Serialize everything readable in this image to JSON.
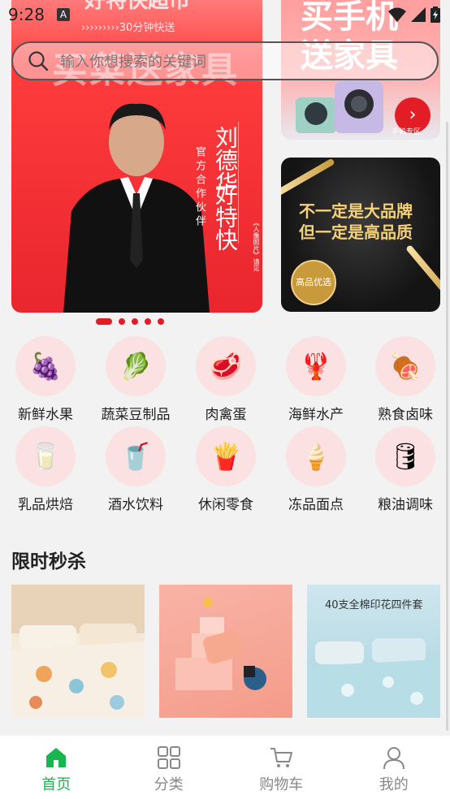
{
  "status": {
    "time": "9:28",
    "notif_icon": "A"
  },
  "search": {
    "placeholder": "输入你想搜索的关键词"
  },
  "banner_main": {
    "brand": "好特快超市",
    "sub": "›››››››››30分钟快送",
    "bg_text": "买菜送家具",
    "name": "刘德华",
    "partner": "好特快",
    "official": "官方合作伙伴",
    "small_note": "《人像照片》请见"
  },
  "banner_phone": {
    "line1": "买手机",
    "line2": "送家具",
    "zone": "手机专区",
    "zone_arrow": "›"
  },
  "banner_quality": {
    "line1": "不一定是大品牌",
    "line2": "但一定是高品质",
    "badge": "高品优选"
  },
  "carousel": {
    "count": 5,
    "active": 0
  },
  "categories": [
    {
      "label": "新鲜水果",
      "icon": "grapes-icon",
      "emoji": "🍇"
    },
    {
      "label": "蔬菜豆制品",
      "icon": "vegetables-icon",
      "emoji": "🥬"
    },
    {
      "label": "肉禽蛋",
      "icon": "meat-icon",
      "emoji": "🥩"
    },
    {
      "label": "海鲜水产",
      "icon": "seafood-icon",
      "emoji": "🦞"
    },
    {
      "label": "熟食卤味",
      "icon": "cooked-food-icon",
      "emoji": "🍖"
    },
    {
      "label": "乳品烘焙",
      "icon": "dairy-icon",
      "emoji": "🥛"
    },
    {
      "label": "酒水饮料",
      "icon": "drinks-icon",
      "emoji": "🥤"
    },
    {
      "label": "休闲零食",
      "icon": "snacks-icon",
      "emoji": "🍟"
    },
    {
      "label": "冻品面点",
      "icon": "frozen-icon",
      "emoji": "🍦"
    },
    {
      "label": "粮油调味",
      "icon": "oil-icon",
      "emoji": "🛢"
    }
  ],
  "flash_sale": {
    "title": "限时秒杀",
    "products": [
      {
        "name": "bedding-set",
        "tag": ""
      },
      {
        "name": "cosmetics-display",
        "tag": ""
      },
      {
        "name": "printed-four-piece-set",
        "tag": "40支全棉印花四件套"
      }
    ]
  },
  "tabs": [
    {
      "label": "首页",
      "icon": "home-icon",
      "active": true
    },
    {
      "label": "分类",
      "icon": "grid-icon",
      "active": false
    },
    {
      "label": "购物车",
      "icon": "cart-icon",
      "active": false
    },
    {
      "label": "我的",
      "icon": "user-icon",
      "active": false
    }
  ],
  "colors": {
    "accent": "#18b64e",
    "brand_red": "#e21d25"
  }
}
